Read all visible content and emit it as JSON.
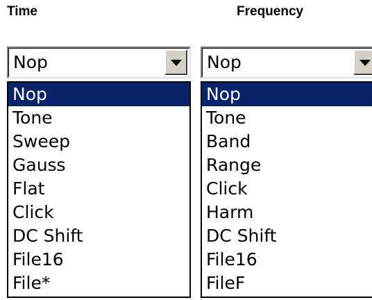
{
  "time": {
    "title": "Time",
    "selected_value": "Nop",
    "options": [
      "Nop",
      "Tone",
      "Sweep",
      "Gauss",
      "Flat",
      "Click",
      "DC Shift",
      "File16",
      "File*"
    ],
    "highlighted_index": 0
  },
  "frequency": {
    "title": "Frequency",
    "selected_value": "Nop",
    "options": [
      "Nop",
      "Tone",
      "Band",
      "Range",
      "Click",
      "Harm",
      "DC Shift",
      "File16",
      "FileF"
    ],
    "highlighted_index": 0
  },
  "colors": {
    "highlight_bg": "#0a246a",
    "highlight_fg": "#ffffff",
    "button_face": "#d4d0c8"
  },
  "icons": {
    "dropdown_arrow": "chevron-down-icon"
  }
}
